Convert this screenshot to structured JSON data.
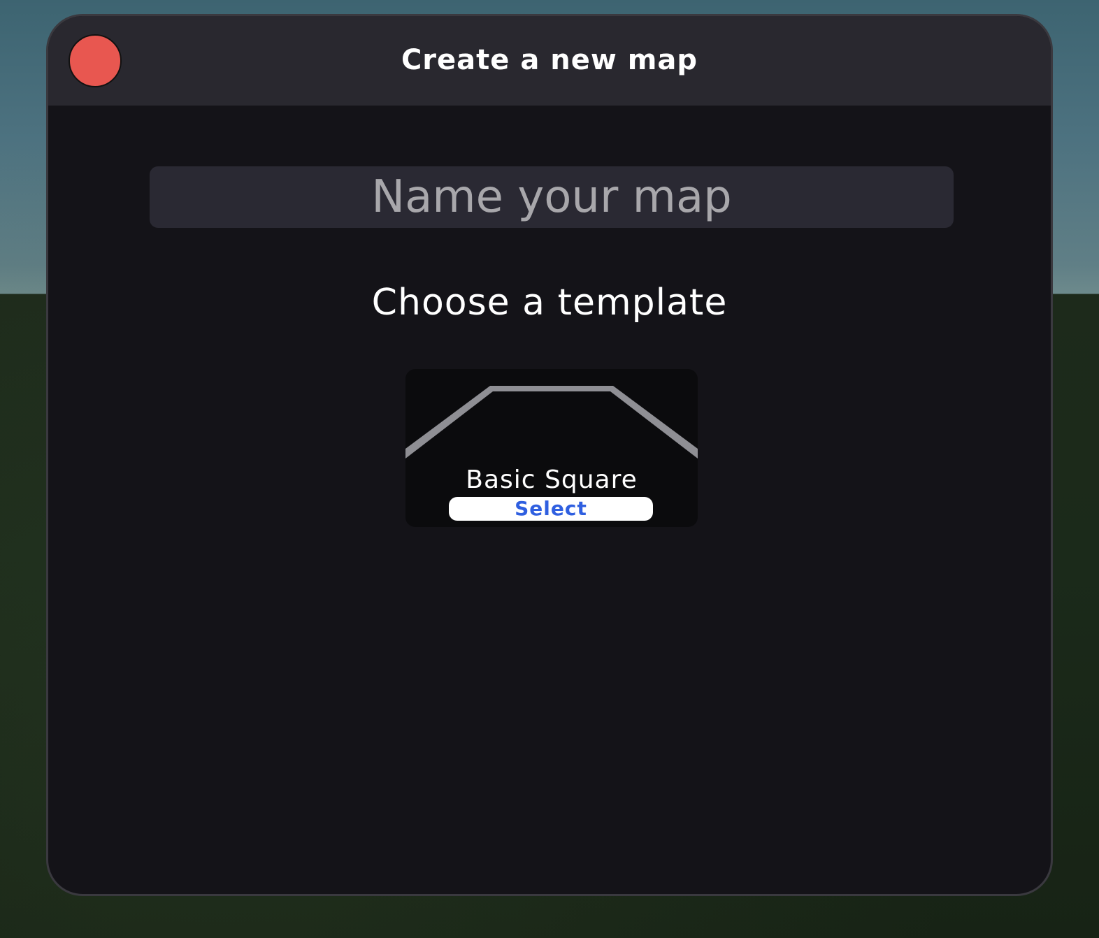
{
  "dialog": {
    "title": "Create a new map",
    "name_input": {
      "value": "",
      "placeholder": "Name your map"
    },
    "section_heading": "Choose a template",
    "templates": [
      {
        "name": "Basic Square",
        "select_label": "Select"
      }
    ]
  },
  "colors": {
    "close_button": "#e85750",
    "titlebar": "#29282f",
    "panel": "#141318",
    "select_text": "#2f5fe0"
  },
  "icons": {
    "close": "close-icon",
    "template_preview": "map-preview-icon"
  }
}
